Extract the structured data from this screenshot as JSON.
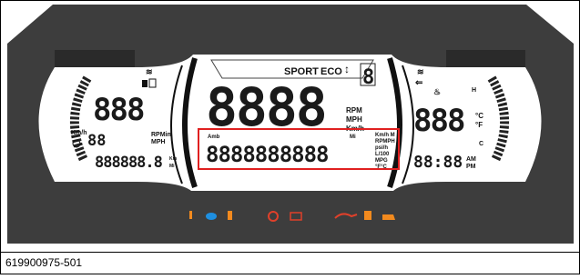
{
  "display": {
    "speed_digits": "8888",
    "speed_units": [
      "RPM",
      "MPH",
      "Km/h"
    ],
    "mode": {
      "sport": "SPORT",
      "eco": "ECO"
    },
    "gear_digit": "8",
    "left": {
      "upper_digits": "888",
      "speed_unit": "Km/h",
      "small_digits": "88",
      "units": [
        "RPMin",
        "MPH"
      ],
      "odometer": "888888.8",
      "odo_units": [
        "Km",
        "Mi"
      ]
    },
    "center": {
      "left_label": "Amb",
      "message": "8888888888",
      "right_label_upper": "Mi",
      "units_right": [
        "Km/h M",
        "RPMPH",
        "psi/h",
        "L/100",
        "MPG",
        "°F°C"
      ]
    },
    "right": {
      "digits": "888",
      "temp_units": [
        "°C",
        "°F"
      ],
      "h_label": "H",
      "c_label": "C",
      "clock": "88:88",
      "am": "AM",
      "pm": "PM"
    }
  },
  "indicators": [
    {
      "name": "warning-indicator-icon",
      "color": "#f28a1e"
    },
    {
      "name": "high-beam-indicator-icon",
      "color": "#1e8fe0"
    },
    {
      "name": "coolant-temp-indicator-icon",
      "color": "#f28a1e"
    },
    {
      "name": "brake-indicator-icon",
      "color": "#e0402a"
    },
    {
      "name": "battery-indicator-icon",
      "color": "#e0402a"
    },
    {
      "name": "oil-pressure-indicator-icon",
      "color": "#e0402a"
    },
    {
      "name": "fuel-indicator-icon",
      "color": "#f28a1e"
    },
    {
      "name": "check-engine-indicator-icon",
      "color": "#f28a1e"
    }
  ],
  "caption": "619900975-501",
  "colors": {
    "panel": "#3d3d3d",
    "lcd": "#ffffff",
    "segment": "#1a1a1a",
    "highlight_box": "#e02020"
  }
}
